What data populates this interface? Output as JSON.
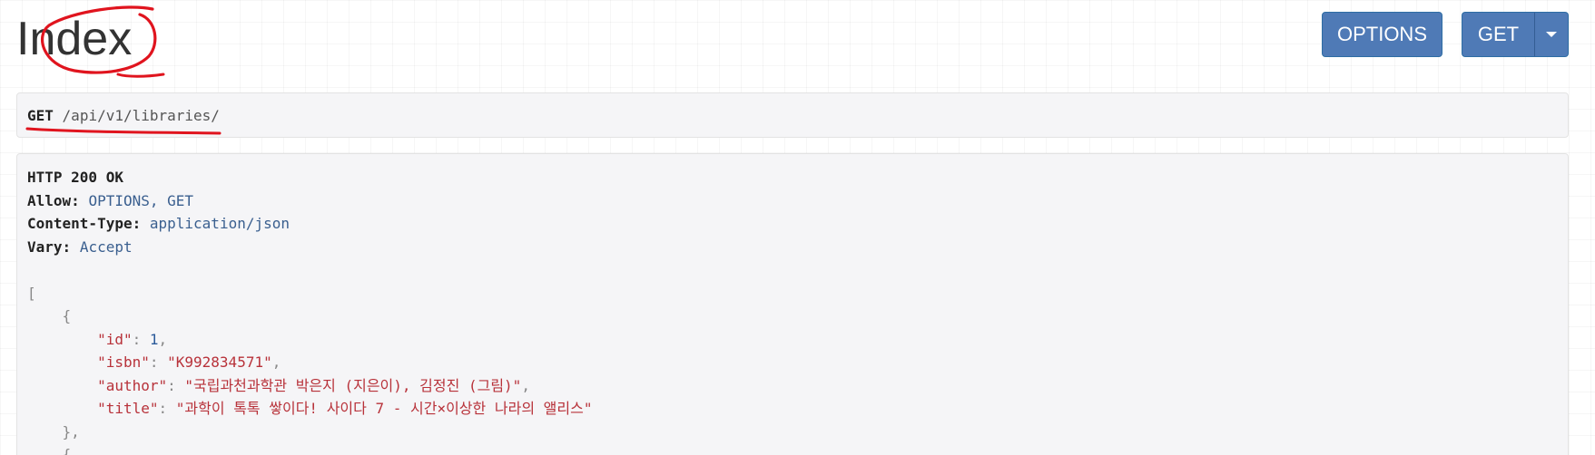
{
  "page": {
    "title": "Index"
  },
  "toolbar": {
    "options_label": "OPTIONS",
    "get_label": "GET"
  },
  "request": {
    "method": "GET",
    "path": "/api/v1/libraries/"
  },
  "response": {
    "status": "HTTP 200 OK",
    "headers": [
      {
        "key": "Allow:",
        "value": "OPTIONS, GET"
      },
      {
        "key": "Content-Type:",
        "value": "application/json"
      },
      {
        "key": "Vary:",
        "value": "Accept"
      }
    ],
    "body": {
      "open_bracket": "[",
      "open_brace": "{",
      "close_brace": "},",
      "next_brace": "{",
      "record": {
        "id_key": "\"id\"",
        "id_value": "1",
        "isbn_key": "\"isbn\"",
        "isbn_value": "\"K992834571\"",
        "author_key": "\"author\"",
        "author_value": "\"국립과천과학관 박은지 (지은이), 김정진 (그림)\"",
        "title_key": "\"title\"",
        "title_value": "\"과학이 톡톡 쌓이다! 사이다 7 - 시간×이상한 나라의 앨리스\""
      }
    }
  },
  "colors": {
    "button_bg": "#4f7ab6",
    "json_string": "#b8323a",
    "json_number": "#2b5a9a",
    "header_value": "#3a5f8f",
    "annotation_red": "#e0141e"
  }
}
